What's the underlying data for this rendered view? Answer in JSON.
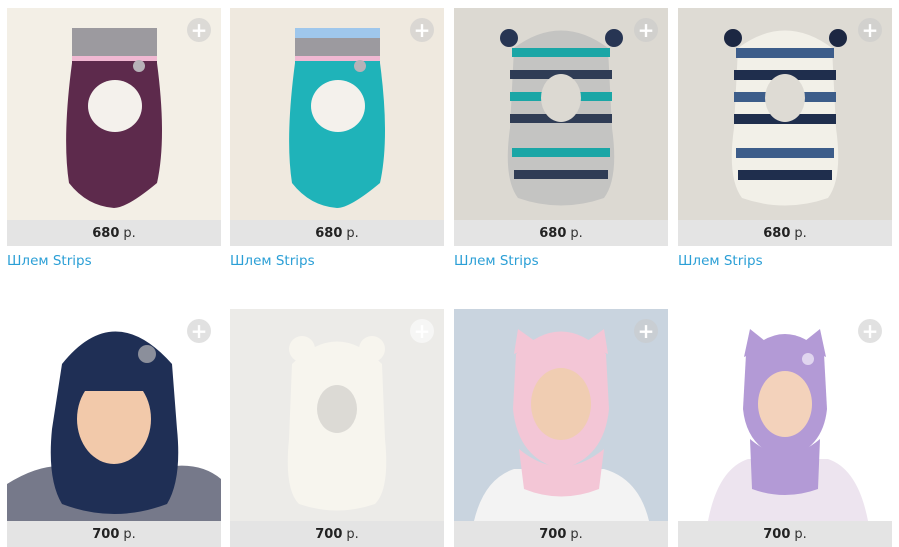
{
  "products": [
    {
      "price": "680",
      "currency": "р.",
      "title": "Шлем Strips",
      "add_icon": "plus-icon"
    },
    {
      "price": "680",
      "currency": "р.",
      "title": "Шлем Strips",
      "add_icon": "plus-icon"
    },
    {
      "price": "680",
      "currency": "р.",
      "title": "Шлем Strips",
      "add_icon": "plus-icon"
    },
    {
      "price": "680",
      "currency": "р.",
      "title": "Шлем Strips",
      "add_icon": "plus-icon"
    },
    {
      "price": "700",
      "currency": "р.",
      "title": "",
      "add_icon": "plus-icon"
    },
    {
      "price": "700",
      "currency": "р.",
      "title": "",
      "add_icon": "plus-icon"
    },
    {
      "price": "700",
      "currency": "р.",
      "title": "",
      "add_icon": "plus-icon"
    },
    {
      "price": "700",
      "currency": "р.",
      "title": "",
      "add_icon": "plus-icon"
    }
  ],
  "colors": {
    "link": "#2b9fd6",
    "price_bar": "#e4e4e4"
  }
}
